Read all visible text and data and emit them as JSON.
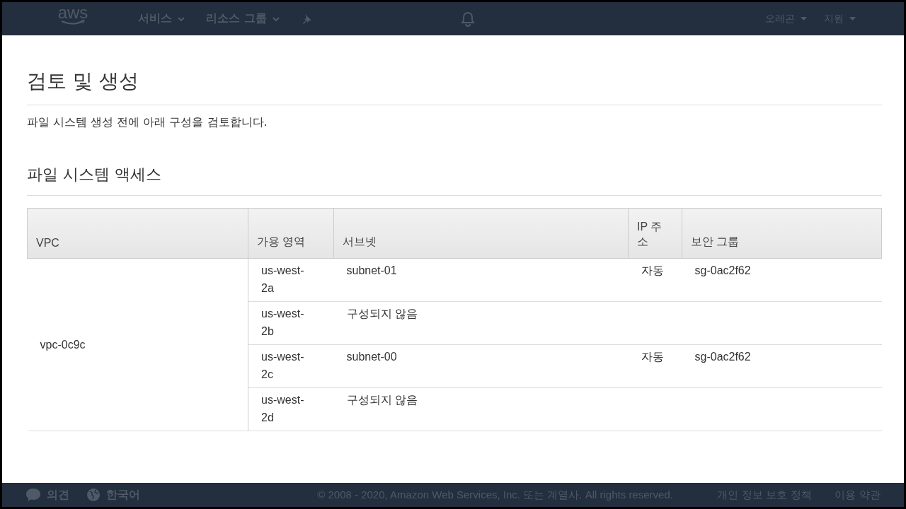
{
  "nav": {
    "logo": "aws",
    "menus": [
      {
        "label": "서비스"
      },
      {
        "label": "리소스 그룹"
      }
    ],
    "right_menus": [
      {
        "label": "오레곤"
      },
      {
        "label": "지원"
      }
    ]
  },
  "page": {
    "title": "검토 및 생성",
    "description": "파일 시스템 생성 전에 아래 구성을 검토합니다."
  },
  "section": {
    "title": "파일 시스템 액세스"
  },
  "table": {
    "columns": [
      "VPC",
      "가용 영역",
      "서브넷",
      "IP 주소",
      "보안 그룹"
    ],
    "vpc": "vpc-0c9c",
    "rows": [
      {
        "zone": "us-west-2a",
        "subnet": "subnet-01",
        "ip": "자동",
        "security_group": "sg-0ac2f62"
      },
      {
        "zone": "us-west-2b",
        "subnet": "구성되지 않음"
      },
      {
        "zone": "us-west-2c",
        "subnet": "subnet-00",
        "ip": "자동",
        "security_group": "sg-0ac2f62"
      },
      {
        "zone": "us-west-2d",
        "subnet": "구성되지 않음"
      }
    ]
  },
  "footer": {
    "feedback": "의견",
    "language": "한국어",
    "copyright": "© 2008 - 2020, Amazon Web Services, Inc. 또는 계열사. All rights reserved.",
    "links": [
      "개인 정보 보호 정책",
      "이용 약관"
    ]
  }
}
